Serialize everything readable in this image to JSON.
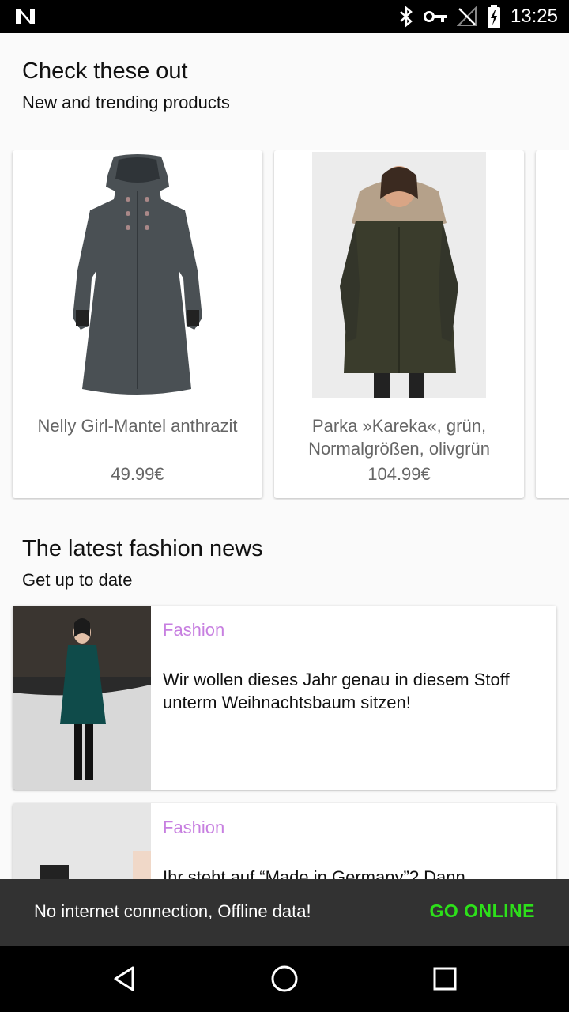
{
  "status_bar": {
    "time": "13:25",
    "icons": [
      "n-logo-icon",
      "bluetooth-icon",
      "vpn-key-icon",
      "no-signal-icon",
      "battery-charging-icon"
    ]
  },
  "trending": {
    "title": "Check these out",
    "subtitle": "New and trending products",
    "products": [
      {
        "name": "Nelly Girl-Mantel anthrazit",
        "price": "49.99€"
      },
      {
        "name": "Parka »Kareka«, grün, Normalgrößen, olivgrün",
        "price": "104.99€"
      }
    ]
  },
  "news": {
    "title": "The latest fashion news",
    "subtitle": "Get up to date",
    "items": [
      {
        "category": "Fashion",
        "headline": "Wir wollen dieses Jahr genau in diesem Stoff unterm Weihnachtsbaum sitzen!"
      },
      {
        "category": "Fashion",
        "headline": "Ihr steht auf “Made in Germany”? Dann"
      }
    ]
  },
  "snackbar": {
    "message": "No internet connection, Offline data!",
    "action": "GO ONLINE"
  },
  "colors": {
    "category": "#c77fe0",
    "action": "#2de01a",
    "snackbar_bg": "#323232"
  }
}
